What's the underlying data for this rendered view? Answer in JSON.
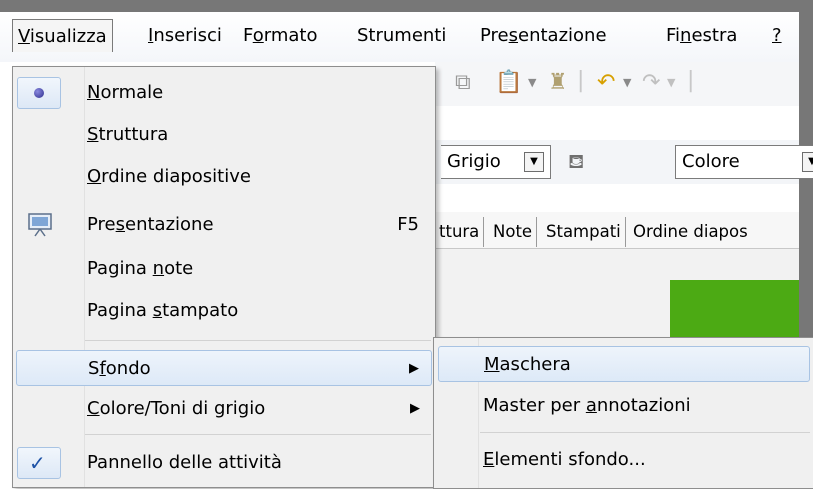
{
  "menubar": {
    "items": [
      {
        "pre": "",
        "key": "V",
        "post": "isualizza"
      },
      {
        "pre": "",
        "key": "I",
        "post": "nserisci"
      },
      {
        "pre": "F",
        "key": "o",
        "post": "rmato"
      },
      {
        "pre": "Strumenti",
        "key": "",
        "post": ""
      },
      {
        "pre": "Pre",
        "key": "s",
        "post": "entazione"
      },
      {
        "pre": "Fi",
        "key": "n",
        "post": "estra"
      },
      {
        "pre": "",
        "key": "?",
        "post": ""
      }
    ]
  },
  "toolbar": {
    "color_mode_combo": "Grigio",
    "fill_combo": "Colore"
  },
  "view_tabs": [
    "ttura",
    "Note",
    "Stampati",
    "Ordine diapos"
  ],
  "view_menu": {
    "items": [
      {
        "pre": "",
        "key": "N",
        "post": "ormale",
        "accel": ""
      },
      {
        "pre": "",
        "key": "S",
        "post": "truttura",
        "accel": ""
      },
      {
        "pre": "",
        "key": "O",
        "post": "rdine diapositive",
        "accel": ""
      },
      {
        "pre": "Pre",
        "key": "s",
        "post": "entazione",
        "accel": "F5"
      },
      {
        "pre": "Pagina ",
        "key": "n",
        "post": "ote",
        "accel": ""
      },
      {
        "pre": "Pagina ",
        "key": "s",
        "post": "tampato",
        "accel": ""
      },
      {
        "pre": "S",
        "key": "f",
        "post": "ondo",
        "accel": ""
      },
      {
        "pre": "",
        "key": "C",
        "post": "olore/Toni di grigio",
        "accel": ""
      },
      {
        "pre": "Pannello delle attività",
        "key": "",
        "post": "",
        "accel": ""
      }
    ]
  },
  "background_submenu": {
    "items": [
      {
        "pre": "",
        "key": "M",
        "post": "aschera"
      },
      {
        "pre": "Master per ",
        "key": "a",
        "post": "nnotazioni"
      },
      {
        "pre": "",
        "key": "E",
        "post": "lementi sfondo..."
      }
    ]
  },
  "icons": {
    "normal_view": "radio-bullet-icon",
    "slideshow": "projector-screen-icon",
    "task_pane": "checkmark-icon",
    "submenu": "submenu-arrow-icon",
    "dropdown": "dropdown-arrow-icon"
  }
}
